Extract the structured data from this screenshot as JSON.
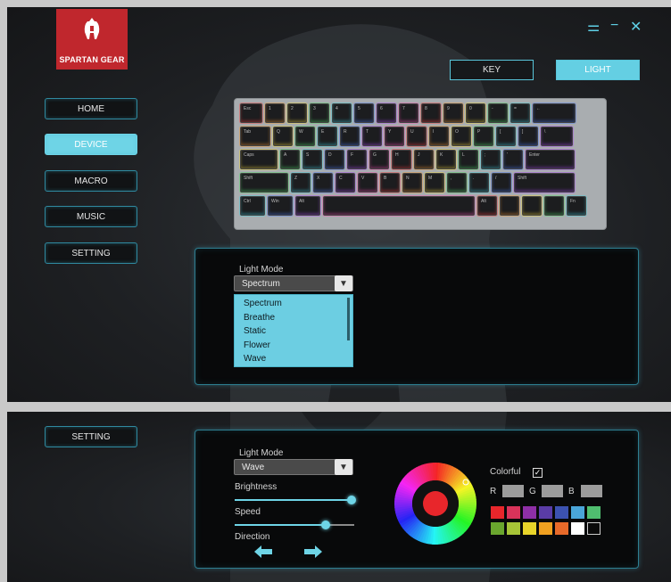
{
  "brand": {
    "name": "SPARTAN GEAR"
  },
  "window": {
    "menu_icon": "⚌",
    "minimize_icon": "−",
    "close_icon": "✕"
  },
  "nav": [
    {
      "label": "HOME",
      "active": false
    },
    {
      "label": "DEVICE",
      "active": true
    },
    {
      "label": "MACRO",
      "active": false
    },
    {
      "label": "MUSIC",
      "active": false
    },
    {
      "label": "SETTING",
      "active": false
    }
  ],
  "tabs": [
    {
      "label": "KEY",
      "active": false
    },
    {
      "label": "LIGHT",
      "active": true
    }
  ],
  "keyboard": {
    "rows": [
      [
        "Esc",
        "1",
        "2",
        "3",
        "4",
        "5",
        "6",
        "7",
        "8",
        "9",
        "0",
        "-",
        "=",
        "←"
      ],
      [
        "Tab",
        "Q",
        "W",
        "E",
        "R",
        "T",
        "Y",
        "U",
        "I",
        "O",
        "P",
        "[",
        "]",
        "\\"
      ],
      [
        "Caps",
        "A",
        "S",
        "D",
        "F",
        "G",
        "H",
        "J",
        "K",
        "L",
        ";",
        "'",
        "Enter"
      ],
      [
        "Shift",
        "Z",
        "X",
        "C",
        "V",
        "B",
        "N",
        "M",
        ",",
        ".",
        "/",
        "Shift"
      ],
      [
        "Ctrl",
        "Win",
        "Alt",
        "",
        "Alt",
        "",
        "",
        "",
        "Fn"
      ]
    ]
  },
  "light_panel_top": {
    "mode_label": "Light Mode",
    "selected": "Spectrum",
    "options": [
      "Spectrum",
      "Breathe",
      "Static",
      "Flower",
      "Wave"
    ]
  },
  "bottom": {
    "setting_label": "SETTING",
    "mode_label": "Light Mode",
    "selected": "Wave",
    "brightness_label": "Brightness",
    "brightness": 0.98,
    "speed_label": "Speed",
    "speed": 0.76,
    "direction_label": "Direction",
    "direction_left": "🡄",
    "direction_right": "🡆",
    "colorful_label": "Colorful",
    "colorful_checked": "✓",
    "r_label": "R",
    "g_label": "G",
    "b_label": "B",
    "selected_color": "#e8262b",
    "palette": [
      [
        "#e8262b",
        "#d9335a",
        "#8e2fa6",
        "#5a3ca6",
        "#3c52b0",
        "#4aa5d8",
        "#4fbe6f"
      ],
      [
        "#6aa62e",
        "#a6c437",
        "#e8d42a",
        "#f0a020",
        "#e86a2a",
        "#ffffff",
        "#0a0a0a"
      ]
    ]
  },
  "accent": "#6ed4e6"
}
